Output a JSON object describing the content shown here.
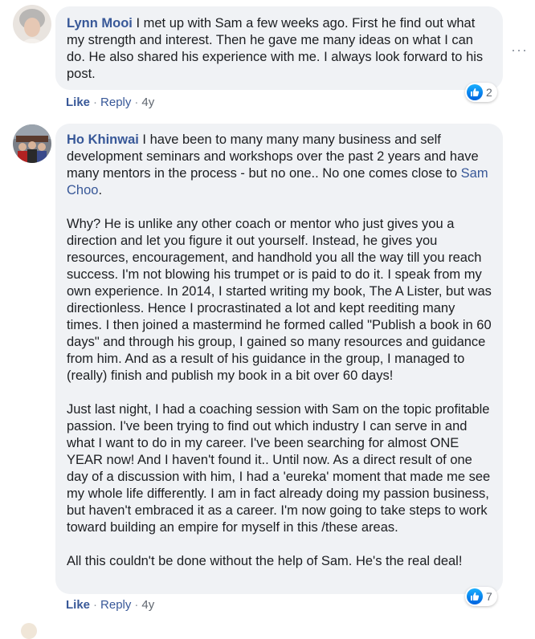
{
  "comments": [
    {
      "author": "Lynn Mooi",
      "text": " I met up with Sam a few weeks ago. First he find out what my strength and interest. Then he gave me many ideas on what I can do. He also shared his experience with me. I always look forward to his post.",
      "like_label": "Like",
      "reply_label": "Reply",
      "time": "4y",
      "reaction_count": "2"
    },
    {
      "author": "Ho Khinwai",
      "text_p1_before": " I have been to many many many business and self development seminars and workshops over the past 2 years and have many mentors in the process - but no one.. No one comes close to ",
      "mention": "Sam Choo",
      "text_p1_after": ".",
      "text_p2": "Why? He is unlike any other coach or mentor who just gives you a direction and let you figure it out yourself. Instead, he gives you resources, encouragement, and handhold you all the way till you reach success. I'm not blowing his trumpet or is paid to do it. I speak from my own experience. In 2014, I started writing my book, The A Lister, but was directionless. Hence I procrastinated a lot and kept reediting many times. I then joined a mastermind he formed called \"Publish a book in 60 days\" and through his group, I gained so many resources and guidance from him. And as a result of his guidance in the group, I managed to (really) finish and publish my book in a bit over 60 days!",
      "text_p3": "Just last night, I had a coaching session with Sam on the topic profitable passion. I've been trying to find out which industry I can serve in and what I want to do in my career. I've been searching for almost ONE YEAR now! And I haven't found it.. Until now. As a direct result of one day of a discussion with him, I had a 'eureka' moment that made me see my whole life differently. I am in fact already doing my passion business, but haven't embraced it as a career. I'm now going to take steps to work toward building an empire for myself in this /these areas.",
      "text_p4": "All this couldn't be done without the help of Sam. He's the real deal!",
      "like_label": "Like",
      "reply_label": "Reply",
      "time": "4y",
      "reaction_count": "7"
    }
  ],
  "more_label": "···",
  "icons": {
    "like_badge": "thumbs-up-icon",
    "more": "more-options-icon"
  },
  "colors": {
    "link": "#385898",
    "bubble": "#f0f2f5",
    "like_badge": "#1877f2"
  }
}
